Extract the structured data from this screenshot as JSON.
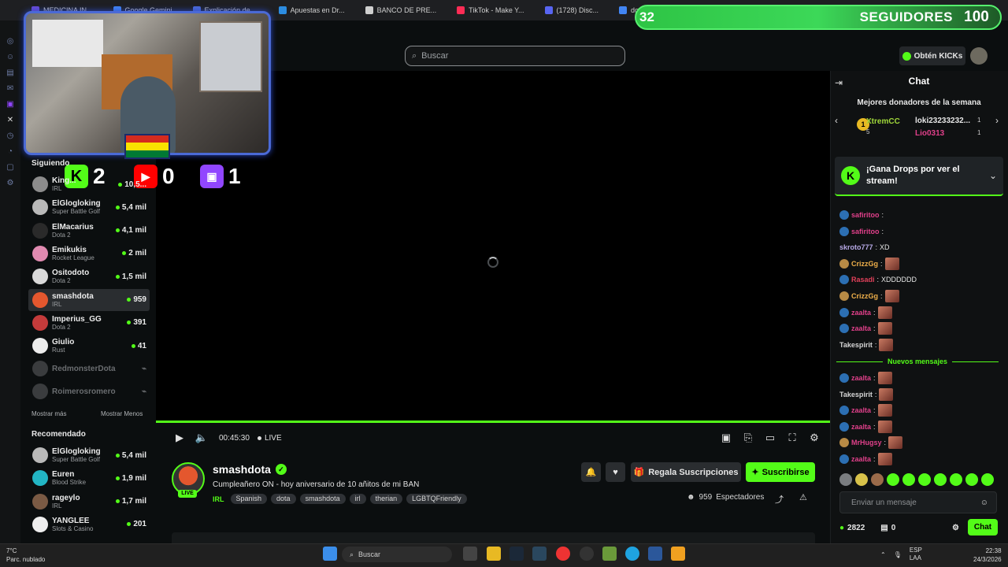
{
  "browser": {
    "tabs": [
      {
        "label": "MEDICINA IN...",
        "color": "#6a4bd6"
      },
      {
        "label": "Google Gemini",
        "color": "#4285f4"
      },
      {
        "label": "Explicación de ...",
        "color": "#4b6ad6"
      },
      {
        "label": "Apuestas en Dr...",
        "color": "#2c8ce0"
      },
      {
        "label": "BANCO DE PRE...",
        "color": "#cfcfcf"
      },
      {
        "label": "TikTok - Make Y...",
        "color": "#fe2c55"
      },
      {
        "label": "(1728) Disc...",
        "color": "#5865f2"
      },
      {
        "label": "doxiciclina - Bu...",
        "color": "#4285f4"
      }
    ]
  },
  "overlay": {
    "followers_current": "32",
    "followers_label": "SEGUIDORES",
    "followers_goal": "100",
    "kick_count": "2",
    "youtube_count": "0",
    "twitch_count": "1"
  },
  "header": {
    "search_placeholder": "Buscar",
    "kicks_button": "Obtén KICKs"
  },
  "sidebar": {
    "following_title": "Siguiendo",
    "following": [
      {
        "name": "King...",
        "category": "IRL",
        "viewers": "10,5...",
        "color": "#8c8c8c"
      },
      {
        "name": "ElGlogloking",
        "category": "Super Battle Golf",
        "viewers": "5,4 mil",
        "color": "#b9b9b9"
      },
      {
        "name": "ElMacarius",
        "category": "Dota 2",
        "viewers": "4,1 mil",
        "color": "#2a2a2a"
      },
      {
        "name": "Emikukis",
        "category": "Rocket League",
        "viewers": "2 mil",
        "color": "#e08ab0"
      },
      {
        "name": "Ositodoto",
        "category": "Dota 2",
        "viewers": "1,5 mil",
        "color": "#d9d9d9"
      },
      {
        "name": "smashdota",
        "category": "IRL",
        "viewers": "959",
        "color": "#e4572e"
      },
      {
        "name": "Imperius_GG",
        "category": "Dota 2",
        "viewers": "391",
        "color": "#c43b3b"
      },
      {
        "name": "Giulio",
        "category": "Rust",
        "viewers": "41",
        "color": "#ececec"
      }
    ],
    "offline": [
      {
        "name": "RedmonsterDota"
      },
      {
        "name": "Roimerosromero"
      }
    ],
    "show_more": "Mostrar más",
    "show_less": "Mostrar Menos",
    "recommended_title": "Recomendado",
    "recommended": [
      {
        "name": "ElGlogloking",
        "category": "Super Battle Golf",
        "viewers": "5,4 mil",
        "color": "#b9b9b9"
      },
      {
        "name": "Euren",
        "category": "Blood Strike",
        "viewers": "1,9 mil",
        "color": "#22b5c4"
      },
      {
        "name": "rageylo",
        "category": "IRL",
        "viewers": "1,7 mil",
        "color": "#7a5a44"
      },
      {
        "name": "YANGLEE",
        "category": "Slots & Casino",
        "viewers": "201",
        "color": "#eeeeee"
      }
    ]
  },
  "player": {
    "time": "00:45:30",
    "live_label": "LIVE"
  },
  "stream": {
    "name": "smashdota",
    "title": "Cumpleañero ON - hoy aniversario de 10 añitos de mi BAN",
    "live_badge": "LIVE",
    "category": "IRL",
    "tags": [
      "Spanish",
      "dota",
      "smashdota",
      "irl",
      "therian",
      "LGBTQFriendly"
    ],
    "gift_button": "Regala Suscripciones",
    "subscribe_button": "Suscribirse",
    "viewers": "959",
    "viewers_label": "Espectadores"
  },
  "chat": {
    "title": "Chat",
    "donors_title": "Mejores donadores de la semana",
    "donors": [
      {
        "rank": "1",
        "name": "XtremCC",
        "amount": "5"
      },
      {
        "name": "loki23233232...",
        "amount": "1"
      },
      {
        "name": "Lio0313",
        "amount": "1"
      }
    ],
    "drops_text": "¡Gana Drops por ver el stream!",
    "messages": [
      {
        "user": "safiritoo",
        "text": "",
        "color": "#e0408a",
        "emote": false
      },
      {
        "user": "safiritoo",
        "text": "",
        "color": "#e0408a",
        "emote": false
      },
      {
        "user": "skroto777",
        "text": "XD",
        "color": "#b7a9e6",
        "emote": false
      },
      {
        "user": "CrizzGg",
        "text": "",
        "color": "#f0b04a",
        "emote": true
      },
      {
        "user": "Rasadi",
        "text": "XDDDDDD",
        "color": "#e0405a",
        "emote": false
      },
      {
        "user": "CrizzGg",
        "text": "",
        "color": "#f0b04a",
        "emote": true
      },
      {
        "user": "zaalta",
        "text": "",
        "color": "#e0408a",
        "emote": true
      },
      {
        "user": "zaalta",
        "text": "",
        "color": "#e0408a",
        "emote": true
      },
      {
        "user": "Takespirit",
        "text": "",
        "color": "#d6d6d6",
        "emote": true
      }
    ],
    "new_messages": "Nuevos mensajes",
    "messages_new": [
      {
        "user": "zaalta",
        "text": "",
        "color": "#e0408a"
      },
      {
        "user": "Takespirit",
        "text": "",
        "color": "#d6d6d6"
      },
      {
        "user": "zaalta",
        "text": "",
        "color": "#e0408a"
      },
      {
        "user": "zaalta",
        "text": "",
        "color": "#e0408a"
      },
      {
        "user": "MrHugsy",
        "text": "",
        "color": "#e0408a"
      },
      {
        "user": "zaalta",
        "text": "",
        "color": "#e0408a"
      }
    ],
    "input_placeholder": "Enviar un mensaje",
    "points": "2822",
    "store_count": "0",
    "send_button": "Chat"
  },
  "taskbar": {
    "temperature": "7°C",
    "weather": "Parc. nublado",
    "search": "Buscar",
    "lang_1": "ESP",
    "lang_2": "LAA",
    "time": "22:38",
    "date": "24/3/2026"
  }
}
